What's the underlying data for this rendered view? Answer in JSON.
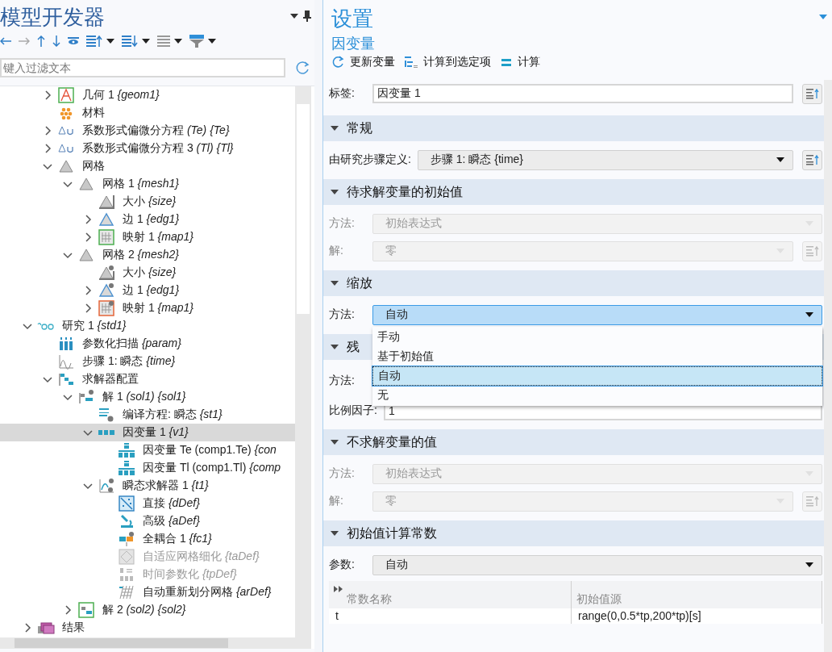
{
  "model_builder": {
    "title": "模型开发器",
    "filter": {
      "placeholder": "键入过滤文本"
    },
    "tree": [
      {
        "children": [
          {
            "label": "几何 1 *{geom1}*",
            "kind": "geometry",
            "expanded": false,
            "selected": false,
            "disabled": false
          },
          {
            "label": "材料",
            "kind": "material",
            "selected": false,
            "disabled": false
          },
          {
            "label": "系数形式偏微分方程 *(Te) {Te}*",
            "kind": "pde",
            "expanded": false,
            "selected": false,
            "disabled": false
          },
          {
            "label": "系数形式偏微分方程 3 *(Tl) {Tl}*",
            "kind": "pde",
            "expanded": false,
            "selected": false,
            "disabled": false
          },
          {
            "label": "网格",
            "kind": "mesh",
            "expanded": true,
            "selected": false,
            "disabled": false,
            "children": [
              {
                "label": "网格 1 *{mesh1}*",
                "kind": "mesh",
                "expanded": true,
                "selected": false,
                "disabled": false,
                "children": [
                  {
                    "label": "大小 *{size}*",
                    "kind": "size",
                    "selected": false,
                    "disabled": false
                  },
                  {
                    "label": "边 1 *{edg1}*",
                    "kind": "edge",
                    "expanded": false,
                    "selected": false,
                    "disabled": false
                  },
                  {
                    "label": "映射 1 *{map1}*",
                    "kind": "mapped",
                    "expanded": false,
                    "selected": false,
                    "disabled": false
                  }
                ]
              },
              {
                "label": "网格 2 *{mesh2}*",
                "kind": "mesh",
                "expanded": true,
                "selected": false,
                "disabled": false,
                "children": [
                  {
                    "label": "大小 *{size}*",
                    "kind": "size_star",
                    "selected": false,
                    "disabled": false
                  },
                  {
                    "label": "边 1 *{edg1}*",
                    "kind": "edge_star",
                    "expanded": false,
                    "selected": false,
                    "disabled": false
                  },
                  {
                    "label": "映射 1 *{map1}*",
                    "kind": "mapped_star",
                    "expanded": false,
                    "selected": false,
                    "disabled": false
                  }
                ]
              }
            ]
          }
        ]
      },
      {
        "label": "研究 1 *{std1}*",
        "kind": "study",
        "expanded": true,
        "selected": false,
        "disabled": false,
        "children": [
          {
            "label": "参数化扫描 *{param}*",
            "kind": "sweep",
            "selected": false,
            "disabled": false
          },
          {
            "label": "步骤 1: 瞬态 *{time}*",
            "kind": "step",
            "selected": false,
            "disabled": false
          },
          {
            "label": "求解器配置",
            "kind": "solver_config",
            "expanded": true,
            "selected": false,
            "disabled": false,
            "children": [
              {
                "label": "解 1 *(sol1) {sol1}*",
                "kind": "solution",
                "expanded": true,
                "selected": false,
                "disabled": false,
                "children": [
                  {
                    "label": "编译方程: 瞬态 *{st1}*",
                    "kind": "compile",
                    "selected": false,
                    "disabled": false
                  },
                  {
                    "label": "因变量 1 *{v1}*",
                    "kind": "variables",
                    "expanded": true,
                    "selected": true,
                    "disabled": false,
                    "children": [
                      {
                        "label": "因变量 Te (comp1.Te) *{con*",
                        "kind": "field",
                        "selected": false,
                        "disabled": false
                      },
                      {
                        "label": "因变量 Tl (comp1.Tl) *{comp*",
                        "kind": "field",
                        "selected": false,
                        "disabled": false
                      }
                    ]
                  },
                  {
                    "label": "瞬态求解器 1 *{t1}*",
                    "kind": "time_solver",
                    "expanded": true,
                    "selected": false,
                    "disabled": false,
                    "children": [
                      {
                        "label": "直接 *{dDef}*",
                        "kind": "direct",
                        "selected": false,
                        "disabled": false
                      },
                      {
                        "label": "高级 *{aDef}*",
                        "kind": "advanced",
                        "selected": false,
                        "disabled": false
                      },
                      {
                        "label": "全耦合 1 *{fc1}*",
                        "kind": "coupled",
                        "selected": false,
                        "disabled": false
                      },
                      {
                        "label": "自适应网格细化 *{taDef}*",
                        "kind": "adaptive",
                        "selected": false,
                        "disabled": true
                      },
                      {
                        "label": "时间参数化 *{tpDef}*",
                        "kind": "time_param",
                        "selected": false,
                        "disabled": true
                      },
                      {
                        "label": "自动重新划分网格 *{arDef}*",
                        "kind": "remesh",
                        "selected": false,
                        "disabled": false
                      }
                    ]
                  }
                ]
              },
              {
                "label": "解 2 *(sol2) {sol2}*",
                "kind": "solution_stored",
                "expanded": false,
                "selected": false,
                "disabled": false
              }
            ]
          }
        ]
      },
      {
        "label": "结果",
        "kind": "results",
        "expanded": false,
        "selected": false,
        "disabled": false
      }
    ]
  },
  "settings": {
    "title": "设置",
    "subtitle": "因变量",
    "actions": [
      {
        "label": "更新变量",
        "kind": "refresh"
      },
      {
        "label": "计算到选定项",
        "kind": "tree"
      },
      {
        "label": "计算",
        "kind": "equals"
      }
    ],
    "label_field": {
      "label": "标签:",
      "value": "因变量 1",
      "button": true
    },
    "sections": [
      {
        "title": "常规",
        "expanded": true,
        "rows": [
          {
            "kind": "select",
            "label": "由研究步骤定义:",
            "value": "步骤 1: 瞬态 {time}",
            "disabled": false,
            "expanded": false,
            "button": true
          }
        ]
      },
      {
        "title": "待求解变量的初始值",
        "expanded": true,
        "rows": [
          {
            "kind": "select",
            "label": "方法:",
            "value": "初始表达式",
            "disabled": true,
            "expanded": false,
            "button": false
          },
          {
            "kind": "select",
            "label": "解:",
            "value": "零",
            "disabled": true,
            "expanded": false,
            "button": true
          }
        ]
      },
      {
        "title": "缩放",
        "expanded": true,
        "rows": [
          {
            "kind": "select",
            "label": "方法:",
            "value": "自动",
            "disabled": false,
            "expanded": true,
            "button": false,
            "options": [
              {
                "label": "手动",
                "selected": false
              },
              {
                "label": "基于初始值",
                "selected": false
              },
              {
                "label": "自动",
                "selected": true
              },
              {
                "label": "无",
                "selected": false
              }
            ]
          }
        ]
      },
      {
        "title": "残",
        "expanded": true,
        "rows": [
          {
            "kind": "label_only",
            "label": "方法:"
          },
          {
            "kind": "text",
            "label": "比例因子:",
            "value": "1"
          }
        ]
      },
      {
        "title": "不求解变量的值",
        "expanded": true,
        "rows": [
          {
            "kind": "select",
            "label": "方法:",
            "value": "初始表达式",
            "disabled": true,
            "expanded": false,
            "button": false
          },
          {
            "kind": "select",
            "label": "解:",
            "value": "零",
            "disabled": true,
            "expanded": false,
            "button": true
          }
        ]
      },
      {
        "title": "初始值计算常数",
        "expanded": true,
        "rows": [
          {
            "kind": "select",
            "label": "参数:",
            "value": "自动",
            "disabled": false,
            "expanded": false,
            "button": false
          },
          {
            "kind": "table",
            "columns": [
              "常数名称",
              "初始值源"
            ],
            "rows": [
              [
                "t",
                "range(0,0.5*tp,200*tp)[s]"
              ]
            ]
          }
        ]
      }
    ]
  }
}
